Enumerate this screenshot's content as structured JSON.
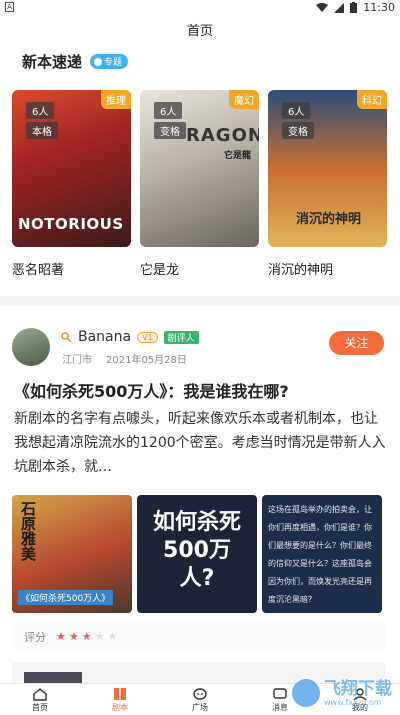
{
  "status_bar": {
    "left_icon": "A",
    "time": "11:30",
    "icons": [
      "wifi-icon",
      "signal-icon",
      "battery-icon"
    ]
  },
  "page_title": "首页",
  "section": {
    "title": "新本速递",
    "tag": "专题"
  },
  "cards": [
    {
      "players": "6人",
      "type": "本格",
      "genre": "推理",
      "name": "恶名昭著",
      "art_text": "NOTORIOUS"
    },
    {
      "players": "6人",
      "type": "变格",
      "genre": "魔幻",
      "name": "它是龙",
      "art_text": "它是龍",
      "art_text2": "RAGON"
    },
    {
      "players": "6人",
      "type": "变格",
      "genre": "科幻",
      "name": "消沉的神明",
      "art_text": "消沉的神明"
    }
  ],
  "post": {
    "username": "Banana",
    "level": "V1",
    "badge": "剧评人",
    "location": "江门市",
    "date": "2021年05月28日",
    "follow_label": "关注",
    "title": "《如何杀死500万人》：我是谁我在哪?",
    "body": "新剧本的名字有点噱头，听起来像欢乐本或者机制本，也让我想起清凉院流水的1200个密室。考虑当时情况是带新人入坑剧本杀，就…",
    "images": [
      {
        "name": "cover-a",
        "text1": "石原雅美",
        "text2": "《如何杀死500万人》"
      },
      {
        "name": "cover-b",
        "text": "如何杀死500万人?"
      },
      {
        "name": "cover-c",
        "text": "这场在孤岛举办的拍卖会，让你们再度相遇，你们是谁？你们最想要的是什么？你们最终的信仰又是什么？这座孤岛会因为你们，而焕发光亮还是再度沉沦黑暗？"
      }
    ],
    "rating_label": "评分",
    "rating": 3,
    "rating_max": 5
  },
  "tabs": [
    {
      "label": "首页",
      "icon": "home-icon",
      "active": false
    },
    {
      "label": "剧本",
      "icon": "book-icon",
      "active": true
    },
    {
      "label": "广场",
      "icon": "square-icon",
      "active": false
    },
    {
      "label": "消息",
      "icon": "message-icon",
      "active": false
    },
    {
      "label": "我的",
      "icon": "profile-icon",
      "active": false
    }
  ],
  "watermark": {
    "text": "飞翔下载",
    "sub": "www.fxxz.com"
  },
  "colors": {
    "accent": "#f26b3d",
    "genre_tag": "#f1a827",
    "topic_tag": "#3fb1f2",
    "reviewer": "#3cb46f",
    "star": "#f15b4b"
  }
}
